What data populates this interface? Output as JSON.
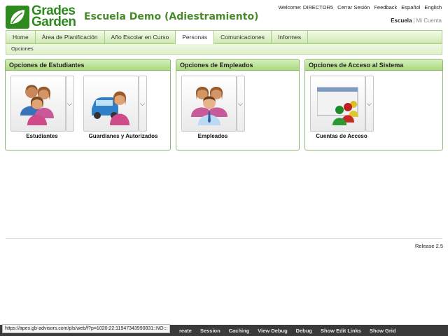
{
  "logo": {
    "line1": "Grades",
    "line2": "Garden"
  },
  "app_title": "Escuela Demo (Adiestramiento)",
  "top_links": [
    "Welcome: DIRECTOR5",
    "Cerrar Sesión",
    "Feedback",
    "Español",
    "English"
  ],
  "account": {
    "active": "Escuela",
    "separator": "|",
    "inactive": "Mi Cuenta"
  },
  "tabs": [
    {
      "label": "Home",
      "active": false
    },
    {
      "label": "Área de Planificación",
      "active": false
    },
    {
      "label": "Año Escolar en Curso",
      "active": false
    },
    {
      "label": "Personas",
      "active": true
    },
    {
      "label": "Comunicaciones",
      "active": false
    },
    {
      "label": "Informes",
      "active": false
    }
  ],
  "subbar": {
    "label": "Opciones"
  },
  "panels": {
    "students": {
      "title": "Opciones de Estudiantes",
      "tile1": "Estudiantes",
      "tile2": "Guardianes y Autorizados"
    },
    "employees": {
      "title": "Opciones de Empleados",
      "tile1": "Empleados"
    },
    "access": {
      "title": "Opciones de Acceso al Sistema",
      "tile1": "Cuentas de Acceso"
    }
  },
  "release": "Release 2.5",
  "status_url": "https://apex.gb-advisors.com/pls/web/f?p=1020:22:11947343990831::NO:::",
  "devbar": [
    "reate",
    "Session",
    "Caching",
    "View Debug",
    "Debug",
    "Show Edit Links",
    "Show Grid"
  ],
  "colors": {
    "brand_green": "#2e8a1f",
    "title_green": "#4a8a2a",
    "panel_header": "#a9d97c"
  }
}
